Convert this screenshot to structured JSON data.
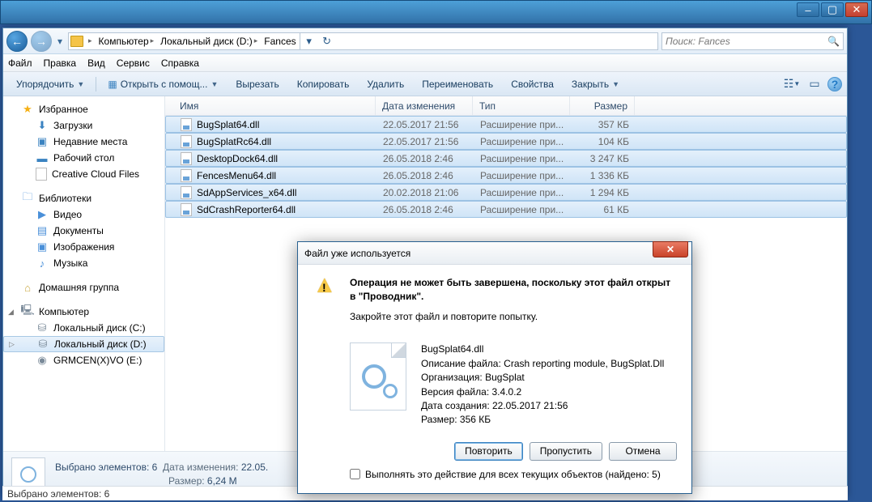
{
  "window_controls": {
    "min": "–",
    "max": "▢",
    "close": "✕"
  },
  "breadcrumb": {
    "root": "Компьютер",
    "drive": "Локальный диск (D:)",
    "folder": "Fances"
  },
  "address_tools": {
    "refresh": "↻",
    "dropdown": "▾"
  },
  "search": {
    "placeholder": "Поиск: Fances",
    "icon": "🔍"
  },
  "menu": {
    "file": "Файл",
    "edit": "Правка",
    "view": "Вид",
    "service": "Сервис",
    "help": "Справка"
  },
  "toolbar": {
    "organize": "Упорядочить",
    "open_with": "Открыть с помощ...",
    "cut": "Вырезать",
    "copy": "Копировать",
    "delete": "Удалить",
    "rename": "Переименовать",
    "properties": "Свойства",
    "close": "Закрыть"
  },
  "tree": {
    "favorites": "Избранное",
    "downloads": "Загрузки",
    "recent": "Недавние места",
    "desktop": "Рабочий стол",
    "ccf": "Creative Cloud Files",
    "libraries": "Библиотеки",
    "video": "Видео",
    "documents": "Документы",
    "pictures": "Изображения",
    "music": "Музыка",
    "homegroup": "Домашняя группа",
    "computer": "Компьютер",
    "drive_c": "Локальный диск (C:)",
    "drive_d": "Локальный диск (D:)",
    "drive_e": "GRMCEN(X)VO (E:)"
  },
  "columns": {
    "name": "Имя",
    "date": "Дата изменения",
    "type": "Тип",
    "size": "Размер"
  },
  "files": [
    {
      "name": "BugSplat64.dll",
      "date": "22.05.2017 21:56",
      "type": "Расширение при...",
      "size": "357 КБ"
    },
    {
      "name": "BugSplatRc64.dll",
      "date": "22.05.2017 21:56",
      "type": "Расширение при...",
      "size": "104 КБ"
    },
    {
      "name": "DesktopDock64.dll",
      "date": "26.05.2018 2:46",
      "type": "Расширение при...",
      "size": "3 247 КБ"
    },
    {
      "name": "FencesMenu64.dll",
      "date": "26.05.2018 2:46",
      "type": "Расширение при...",
      "size": "1 336 КБ"
    },
    {
      "name": "SdAppServices_x64.dll",
      "date": "20.02.2018 21:06",
      "type": "Расширение при...",
      "size": "1 294 КБ"
    },
    {
      "name": "SdCrashReporter64.dll",
      "date": "26.05.2018 2:46",
      "type": "Расширение при...",
      "size": "61 КБ"
    }
  ],
  "details": {
    "selected_label": "Выбрано элементов: 6",
    "date_label": "Дата изменения:",
    "date_value": "22.05.",
    "size_label": "Размер:",
    "size_value": "6,24 M"
  },
  "statusbar": {
    "text": "Выбрано элементов: 6"
  },
  "dialog": {
    "title": "Файл уже используется",
    "msg_line1": "Операция не может быть завершена, поскольку этот файл открыт в \"Проводник\".",
    "msg_line2": "Закройте этот файл и повторите попытку.",
    "file_name": "BugSplat64.dll",
    "desc_label": "Описание файла:",
    "desc_value": "Crash reporting module, BugSplat.Dll",
    "org_label": "Организация:",
    "org_value": "BugSplat",
    "ver_label": "Версия файла:",
    "ver_value": "3.4.0.2",
    "created_label": "Дата создания:",
    "created_value": "22.05.2017 21:56",
    "size_label": "Размер:",
    "size_value": "356 КБ",
    "btn_retry": "Повторить",
    "btn_skip": "Пропустить",
    "btn_cancel": "Отмена",
    "checkbox": "Выполнять это действие для всех текущих объектов (найдено: 5)"
  }
}
